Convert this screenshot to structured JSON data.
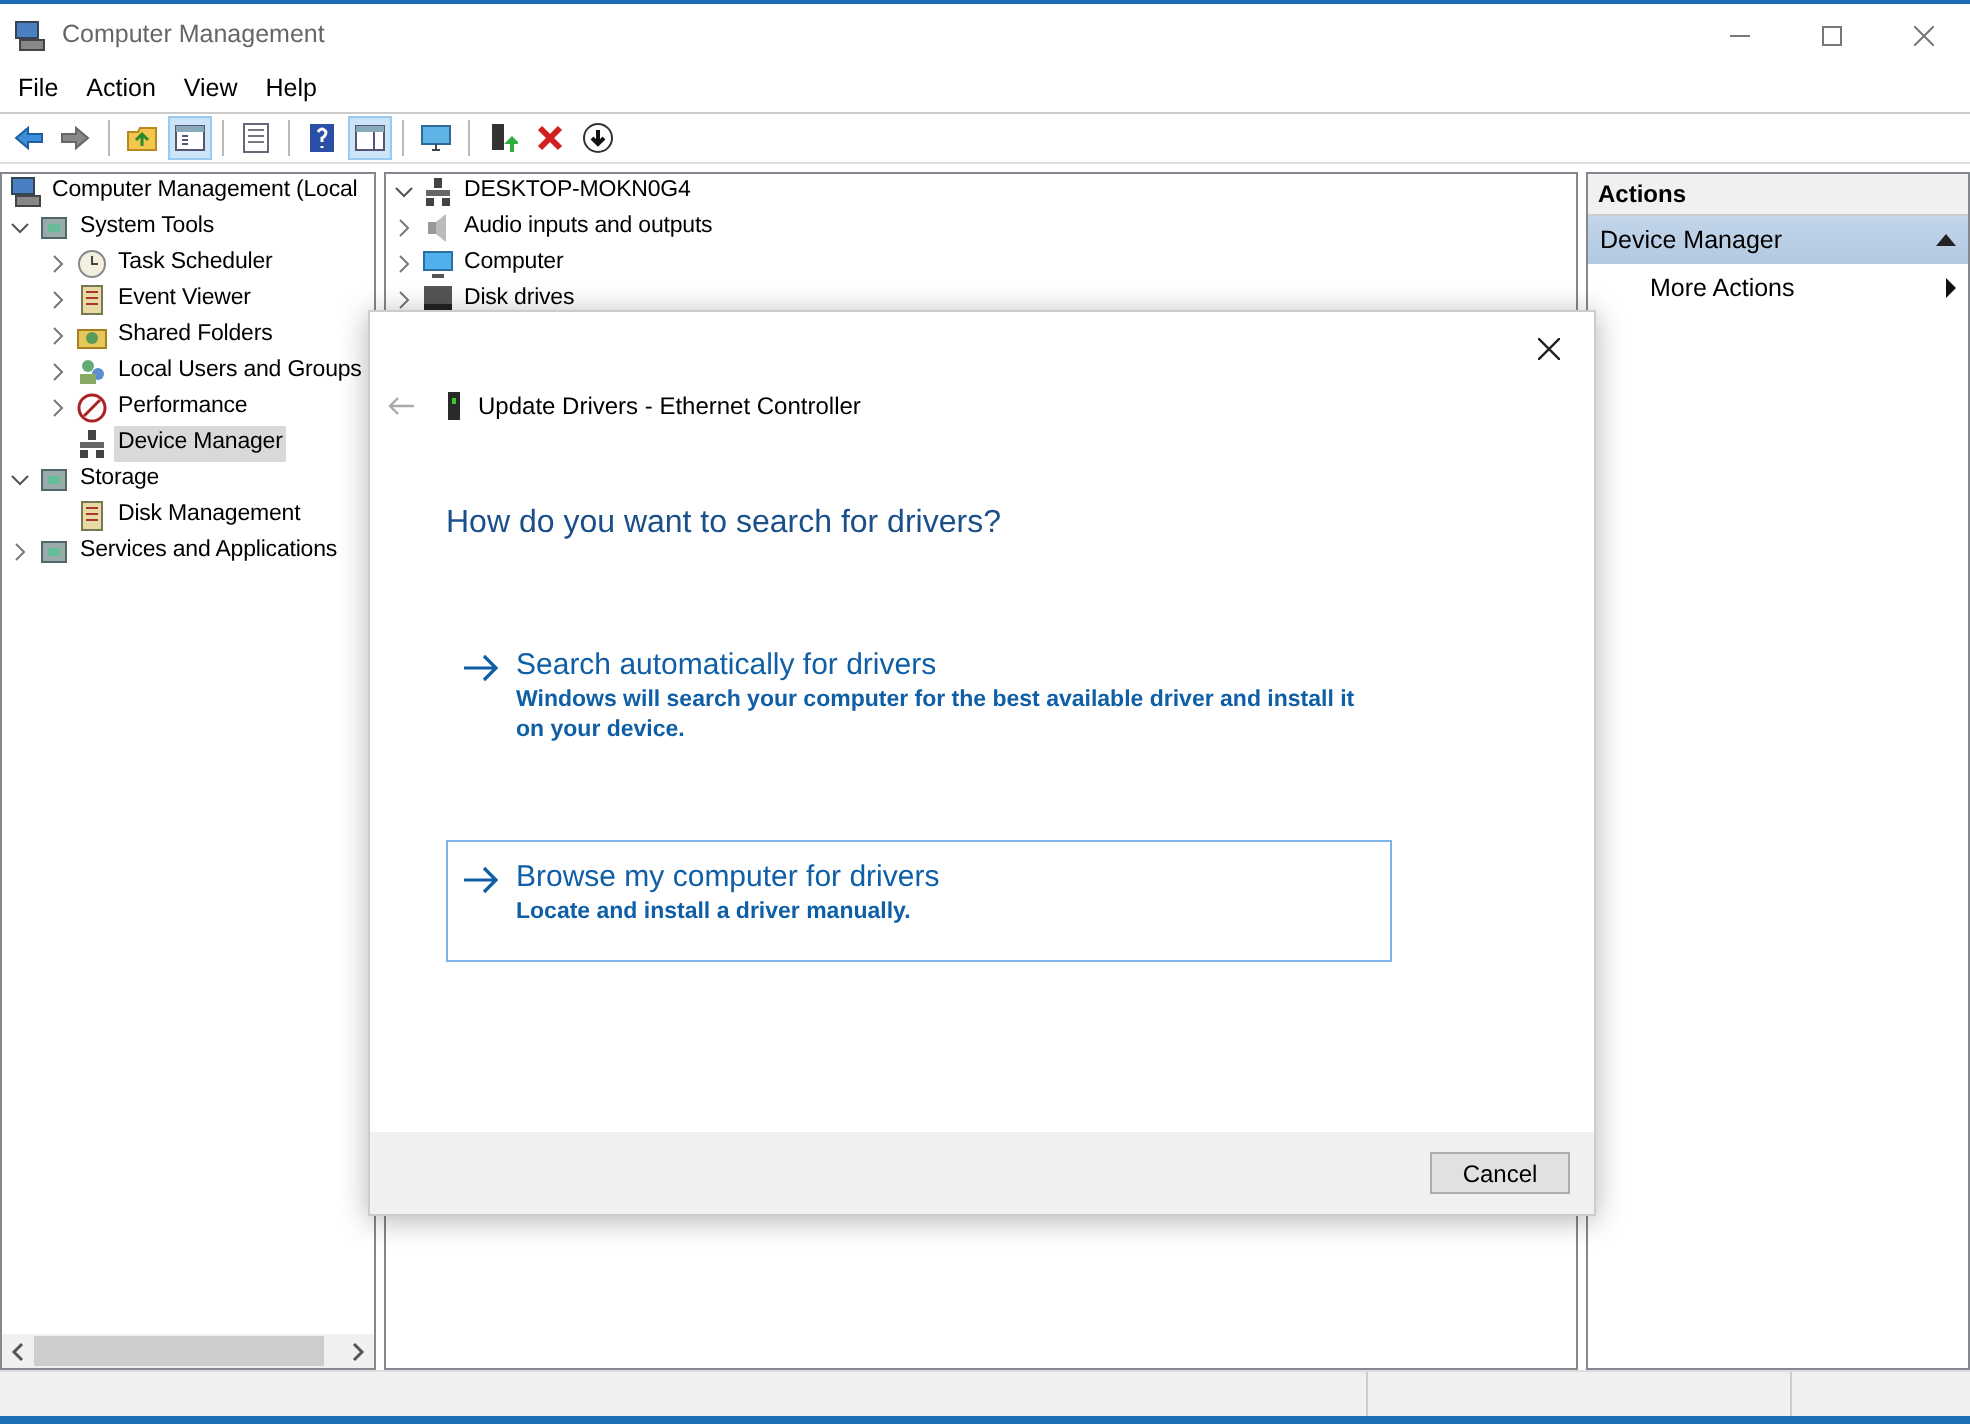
{
  "window": {
    "title": "Computer Management"
  },
  "menu": [
    "File",
    "Action",
    "View",
    "Help"
  ],
  "toolbar": [
    {
      "kind": "back",
      "pressed": false
    },
    {
      "kind": "forward",
      "pressed": false
    },
    {
      "kind": "sep"
    },
    {
      "kind": "up",
      "pressed": false
    },
    {
      "kind": "tree",
      "pressed": true
    },
    {
      "kind": "sep"
    },
    {
      "kind": "properties",
      "pressed": false
    },
    {
      "kind": "sep"
    },
    {
      "kind": "help",
      "pressed": false
    },
    {
      "kind": "pane",
      "pressed": true
    },
    {
      "kind": "sep"
    },
    {
      "kind": "monitor",
      "pressed": false
    },
    {
      "kind": "sep"
    },
    {
      "kind": "update",
      "pressed": false
    },
    {
      "kind": "delete",
      "pressed": false
    },
    {
      "kind": "download",
      "pressed": false
    }
  ],
  "navigation_tree": [
    {
      "label": "Computer Management (Local",
      "selected": false,
      "children": [
        {
          "label": "System Tools",
          "expanded": true,
          "selected": false,
          "children": [
            {
              "label": "Task Scheduler",
              "expanded": false,
              "selected": false
            },
            {
              "label": "Event Viewer",
              "expanded": false,
              "selected": false
            },
            {
              "label": "Shared Folders",
              "expanded": false,
              "selected": false
            },
            {
              "label": "Local Users and Groups",
              "expanded": false,
              "selected": false
            },
            {
              "label": "Performance",
              "expanded": false,
              "selected": false
            },
            {
              "label": "Device Manager",
              "selected": true
            }
          ]
        },
        {
          "label": "Storage",
          "expanded": true,
          "selected": false,
          "children": [
            {
              "label": "Disk Management",
              "selected": false
            }
          ]
        },
        {
          "label": "Services and Applications",
          "expanded": false,
          "selected": false
        }
      ]
    }
  ],
  "device_tree": [
    {
      "label": "DESKTOP-MOKN0G4",
      "expanded": true,
      "children": [
        {
          "label": "Audio inputs and outputs",
          "expanded": false
        },
        {
          "label": "Computer",
          "expanded": false
        },
        {
          "label": "Disk drives",
          "expanded": false
        }
      ]
    }
  ],
  "actions": {
    "header": "Actions",
    "sections": [
      {
        "title": "Device Manager",
        "expanded": true,
        "items": [
          "More Actions"
        ]
      }
    ]
  },
  "dialog": {
    "title": "Update Drivers - Ethernet Controller",
    "heading": "How do you want to search for drivers?",
    "options": [
      {
        "title": "Search automatically for drivers",
        "description": "Windows will search your computer for the best available driver and install it on your device.",
        "focused": false
      },
      {
        "title": "Browse my computer for drivers",
        "description": "Locate and install a driver manually.",
        "focused": true
      }
    ],
    "buttons": [
      "Cancel"
    ]
  }
}
